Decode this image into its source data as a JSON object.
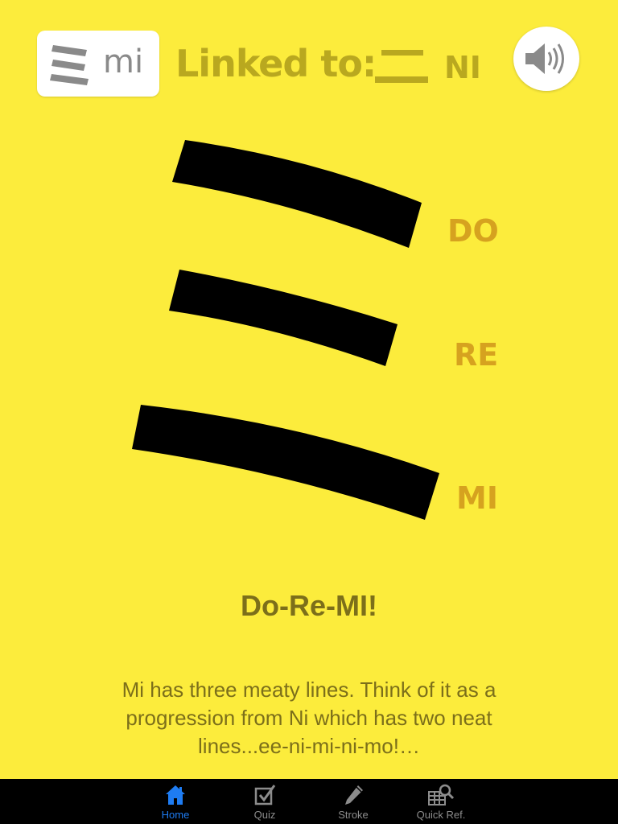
{
  "header": {
    "kana": "ミ",
    "romaji": "mi",
    "linked_label": "Linked to:",
    "linked_kana": "ニ",
    "linked_romaji": "NI",
    "sound_icon": "speaker-icon"
  },
  "stroke_labels": [
    "DO",
    "RE",
    "MI"
  ],
  "headline": "Do-Re-MI!",
  "mnemonic": "Mi has three meaty lines. Think of it as a progression from Ni which has two neat lines...ee-ni-mi-ni-mo!…",
  "tabbar": {
    "tabs": [
      {
        "label": "Home",
        "icon": "home-icon",
        "active": true
      },
      {
        "label": "Quiz",
        "icon": "checkbox-icon",
        "active": false
      },
      {
        "label": "Stroke",
        "icon": "pencil-icon",
        "active": false
      },
      {
        "label": "Quick Ref.",
        "icon": "grid-search-icon",
        "active": false
      }
    ]
  },
  "colors": {
    "background": "#fcec3c",
    "muted_text": "#b9a81f",
    "syllable": "#d6a21f",
    "body_text": "#7c6f1a",
    "tab_active": "#1e7cf2"
  }
}
